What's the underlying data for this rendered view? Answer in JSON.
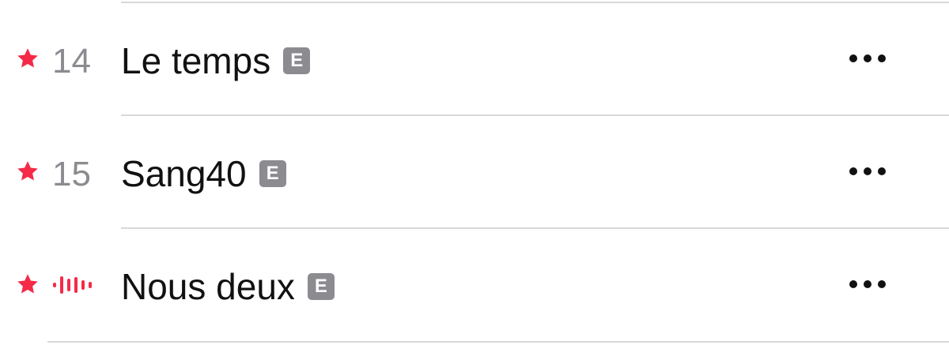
{
  "tracks": [
    {
      "number": "14",
      "title": "Le temps",
      "explicit_label": "E",
      "favorited": true,
      "now_playing": false
    },
    {
      "number": "15",
      "title": "Sang40",
      "explicit_label": "E",
      "favorited": true,
      "now_playing": false
    },
    {
      "number": "",
      "title": "Nous deux",
      "explicit_label": "E",
      "favorited": true,
      "now_playing": true
    }
  ],
  "icons": {
    "favorite": "star-icon",
    "now_playing": "waveform-icon",
    "more": "ellipsis-icon"
  },
  "colors": {
    "accent": "#f52a48",
    "secondary_text": "#8b8b90",
    "primary_text": "#111111",
    "divider": "#d9d9dc"
  }
}
